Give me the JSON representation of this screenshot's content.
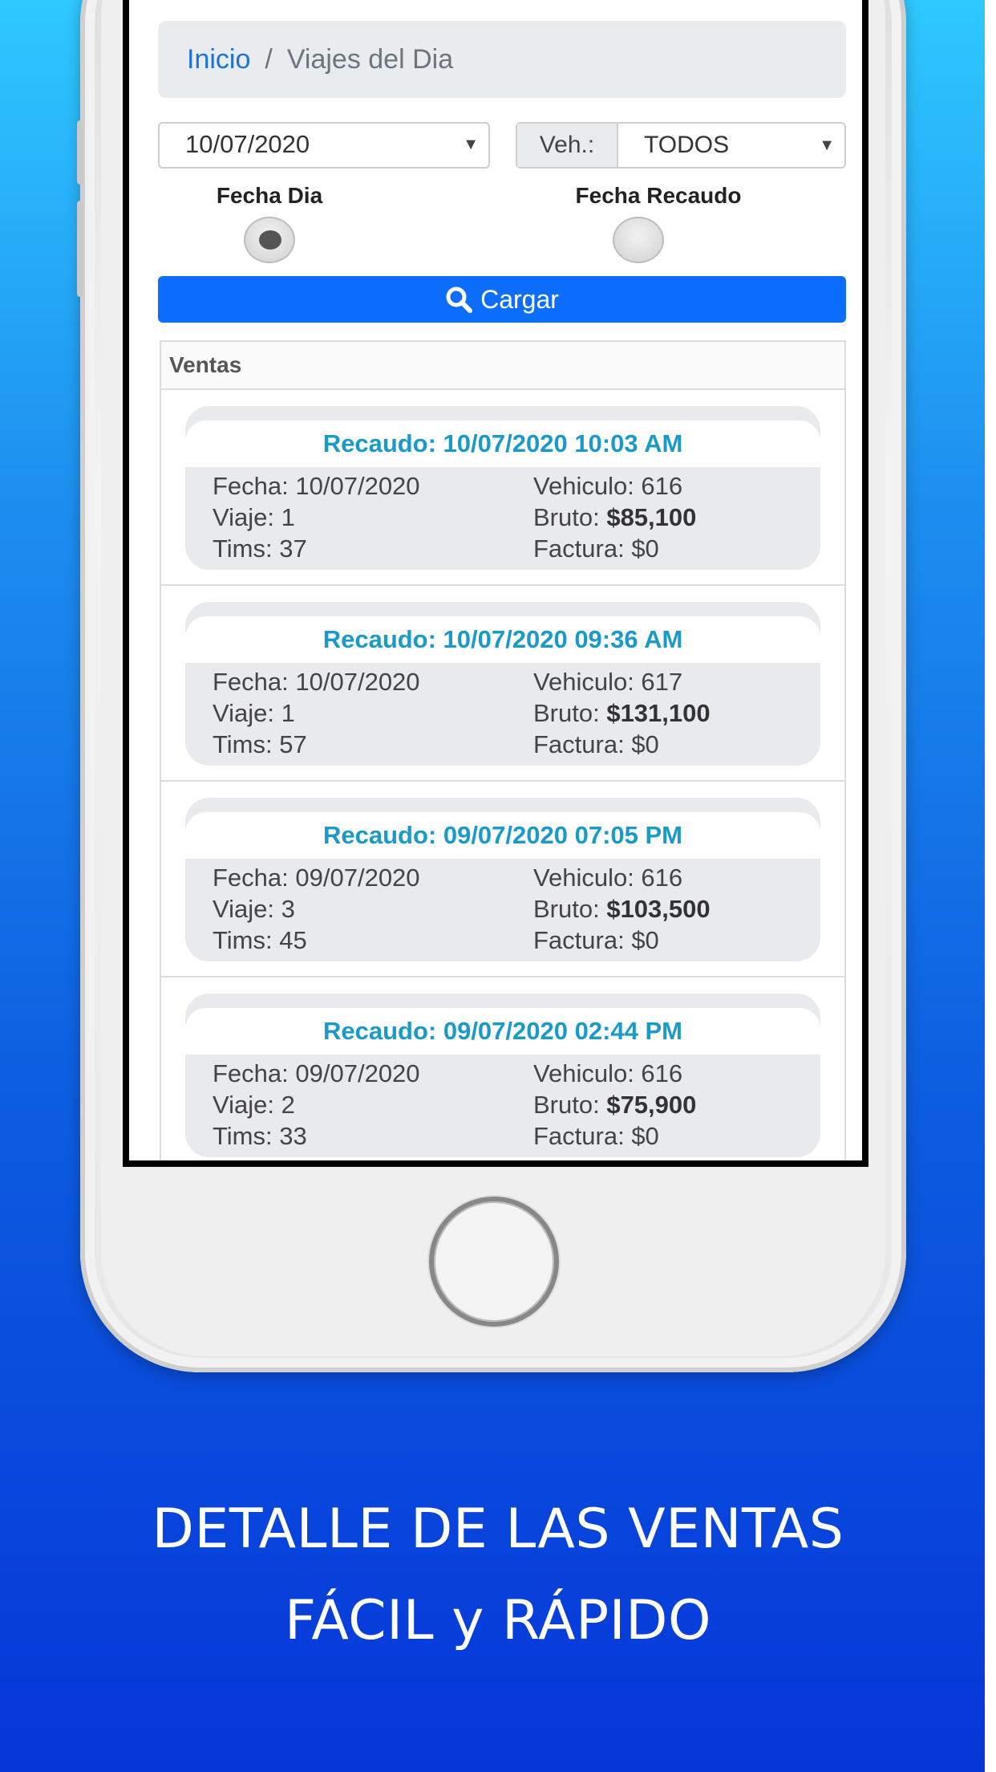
{
  "breadcrumb": {
    "home": "Inicio",
    "separator": "/",
    "current": "Viajes del Dia"
  },
  "filters": {
    "date_value": "10/07/2020",
    "vehicle_label": "Veh.:",
    "vehicle_value": "TODOS",
    "radio_fecha_dia": "Fecha Dia",
    "radio_fecha_recaudo": "Fecha Recaudo",
    "selected_radio": "Fecha Dia"
  },
  "load_button": {
    "label": "Cargar",
    "icon": "search-icon"
  },
  "panel": {
    "title": "Ventas"
  },
  "sales": [
    {
      "recaudo": "Recaudo: 10/07/2020 10:03 AM",
      "fecha": "Fecha: 10/07/2020",
      "viaje": "Viaje: 1",
      "tims": "Tims: 37",
      "vehiculo": "Vehiculo: 616",
      "bruto_label": "Bruto: ",
      "bruto_value": "$85,100",
      "factura": "Factura: $0"
    },
    {
      "recaudo": "Recaudo: 10/07/2020 09:36 AM",
      "fecha": "Fecha: 10/07/2020",
      "viaje": "Viaje: 1",
      "tims": "Tims: 57",
      "vehiculo": "Vehiculo: 617",
      "bruto_label": "Bruto: ",
      "bruto_value": "$131,100",
      "factura": "Factura: $0"
    },
    {
      "recaudo": "Recaudo: 09/07/2020 07:05 PM",
      "fecha": "Fecha: 09/07/2020",
      "viaje": "Viaje: 3",
      "tims": "Tims: 45",
      "vehiculo": "Vehiculo: 616",
      "bruto_label": "Bruto: ",
      "bruto_value": "$103,500",
      "factura": "Factura: $0"
    },
    {
      "recaudo": "Recaudo: 09/07/2020 02:44 PM",
      "fecha": "Fecha: 09/07/2020",
      "viaje": "Viaje: 2",
      "tims": "Tims: 33",
      "vehiculo": "Vehiculo: 616",
      "bruto_label": "Bruto: ",
      "bruto_value": "$75,900",
      "factura": "Factura: $0"
    }
  ],
  "caption": {
    "line1": "DETALLE DE LAS VENTAS",
    "line2": "FÁCIL y RÁPIDO"
  },
  "colors": {
    "primary": "#0d6efd",
    "link": "#1a73d9",
    "recaudo_title": "#199acb",
    "background_top": "#2fc8ff",
    "background_bottom": "#0636d8"
  }
}
